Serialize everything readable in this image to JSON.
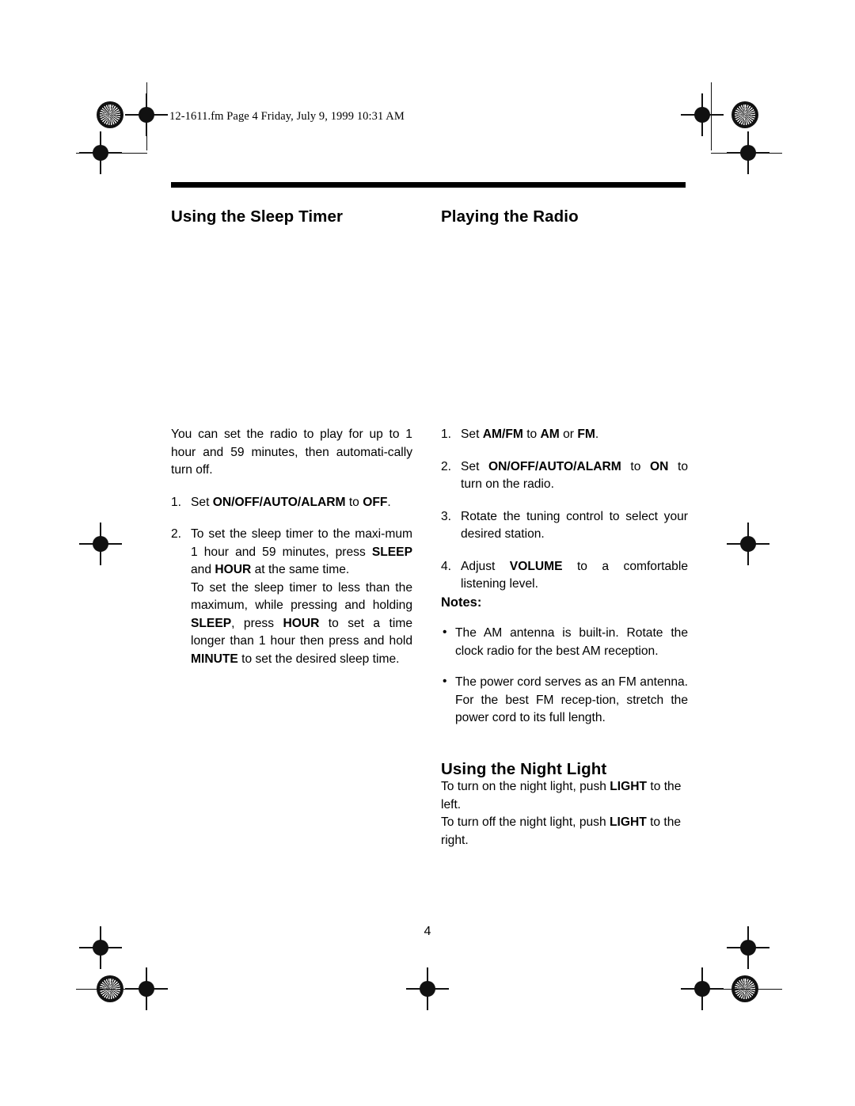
{
  "document": {
    "file_header": "12-1611.fm  Page 4  Friday, July 9, 1999  10:31 AM",
    "page_number": "4"
  },
  "left_column": {
    "heading": "Using the Sleep Timer",
    "intro": "You can set the radio to play for up to 1 hour and 59 minutes, then automati-cally turn off.",
    "steps": [
      {
        "num": "1.",
        "text_html": "Set <b>ON/OFF/AUTO/ALARM</b> to <b>OFF</b>."
      },
      {
        "num": "2.",
        "text_html": "To set the sleep timer to the maxi-mum 1 hour and 59 minutes, press <b>SLEEP</b> and <b>HOUR</b> at the same time."
      }
    ],
    "closing_html": "To set the sleep timer to less than the maximum, while pressing and holding <b>SLEEP</b>, press <b>HOUR</b> to set a time longer than 1 hour then press and hold <b>MINUTE</b> to set the desired sleep time."
  },
  "right_column": {
    "heading_radio": "Playing the Radio",
    "steps": [
      {
        "num": "1.",
        "text_html": "Set <b>AM/FM</b> to <b>AM</b> or <b>FM</b>."
      },
      {
        "num": "2.",
        "text_html": "Set <b>ON/OFF/AUTO/ALARM</b> to <b>ON</b> to turn on the radio."
      },
      {
        "num": "3.",
        "text_html": "Rotate the tuning control to select your desired station."
      },
      {
        "num": "4.",
        "text_html": "Adjust <b>VOLUME</b> to a comfortable listening level."
      }
    ],
    "notes_label": "Notes:",
    "notes": [
      {
        "bullet": "•",
        "text_html": "The AM antenna is built-in. Rotate the clock radio for the best AM reception."
      },
      {
        "bullet": "•",
        "text_html": "The power cord serves as an FM antenna. For the best FM recep-tion, stretch the power cord to its full length."
      }
    ],
    "heading_night_light": "Using the Night Light",
    "night_light_on_html": "To turn on the night light, push <b>LIGHT</b> to the left.",
    "night_light_off_html": "To turn off the night light, push <b>LIGHT</b> to the right."
  }
}
